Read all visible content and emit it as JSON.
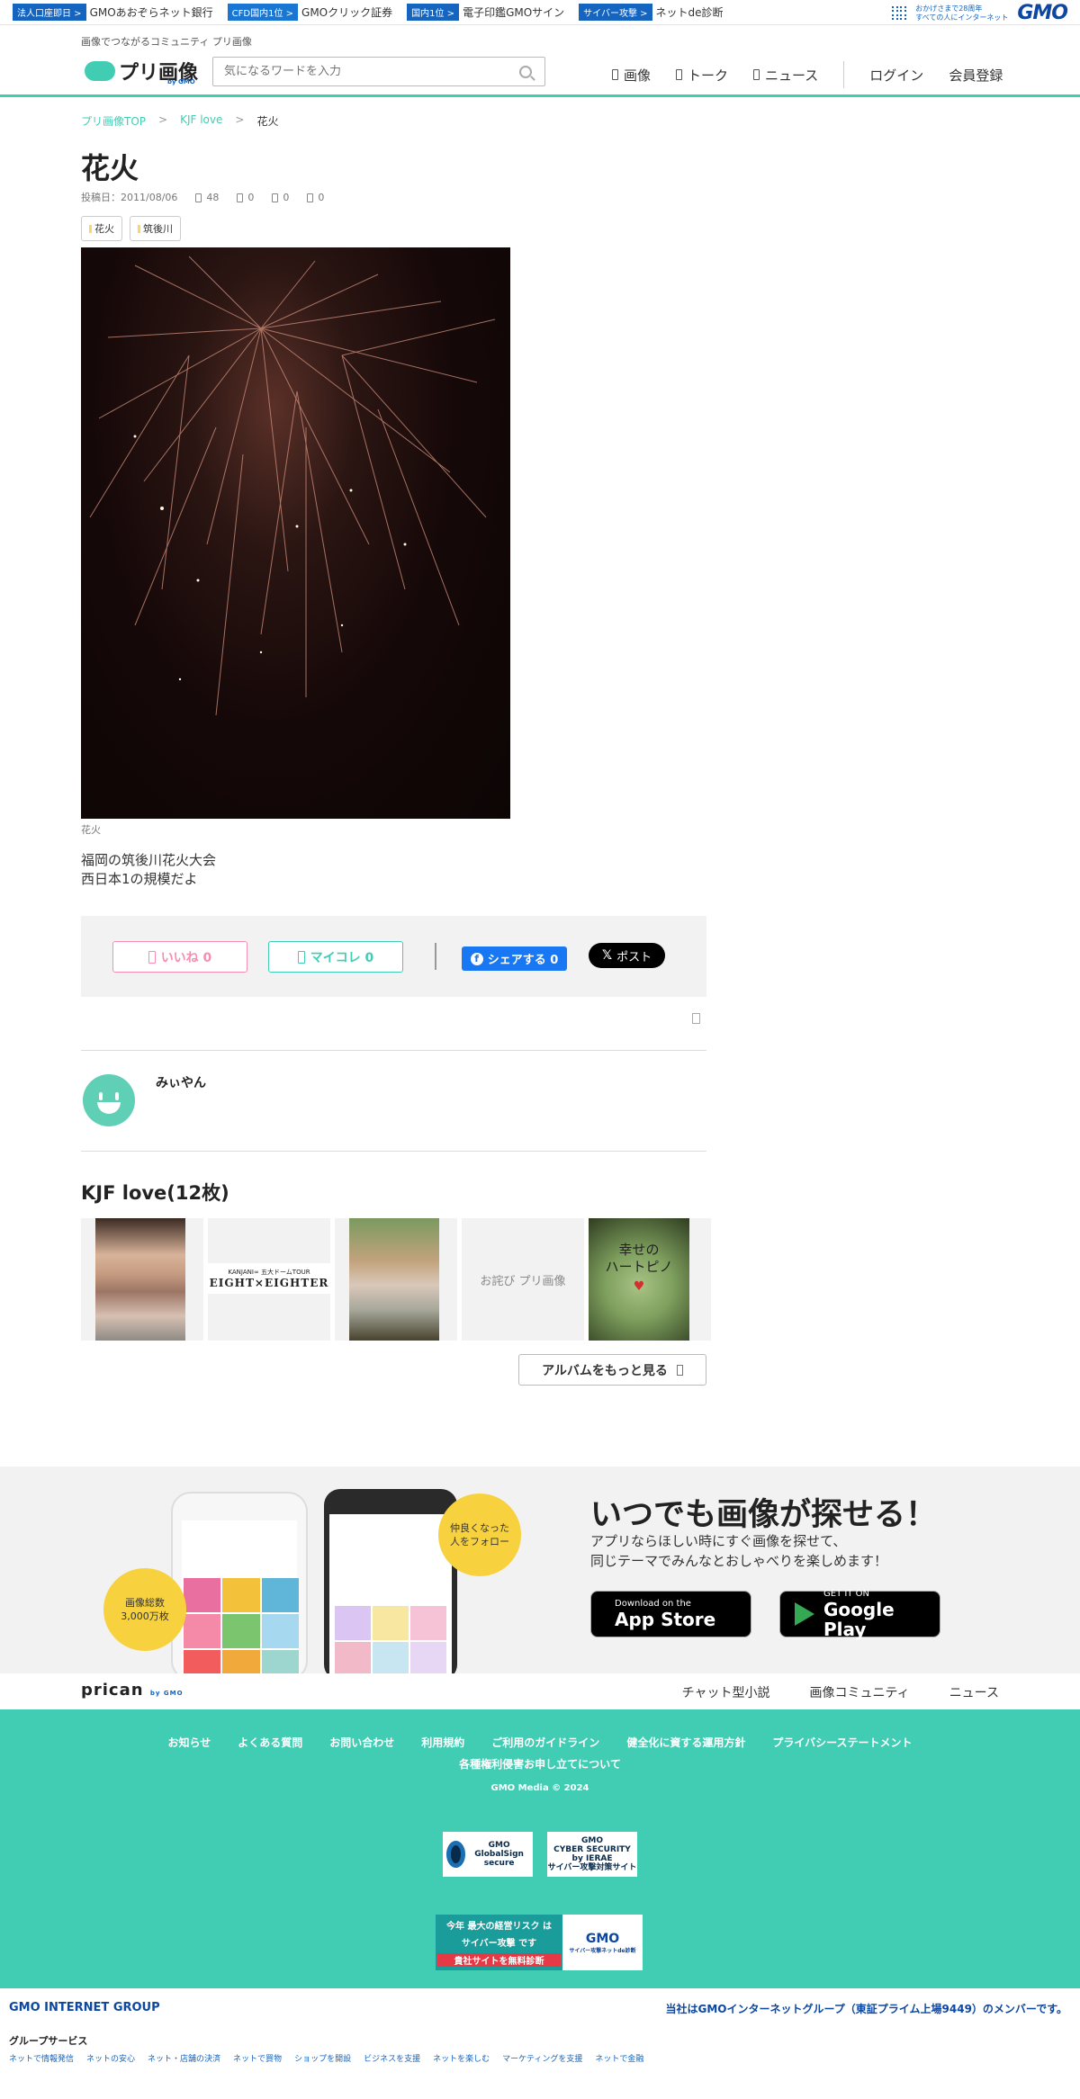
{
  "gmo_bar": {
    "items": [
      {
        "badge": "法人口座即日 >",
        "label": "GMOあおぞらネット銀行"
      },
      {
        "badge": "CFD国内1位 >",
        "label": "GMOクリック証券"
      },
      {
        "badge": "国内1位 >",
        "label": "電子印鑑GMOサイン"
      },
      {
        "badge": "サイバー攻撃 >",
        "label": "ネットde診断"
      }
    ],
    "anniv_line1": "おかげさまで28周年",
    "anniv_line2": "すべての人にインターネット",
    "logo": "GMO"
  },
  "header": {
    "tagline": "画像でつながるコミュニティ プリ画像",
    "logo_text": "プリ画像",
    "logo_by": "by GMO",
    "search_placeholder": "気になるワードを入力",
    "nav": [
      {
        "label": "画像"
      },
      {
        "label": "トーク"
      },
      {
        "label": "ニュース"
      }
    ],
    "login": "ログイン",
    "register": "会員登録"
  },
  "breadcrumb": {
    "items": [
      "プリ画像TOP",
      "KJF love",
      "花火"
    ],
    "sep": ">"
  },
  "post": {
    "title": "花火",
    "date": "投稿日：2011/08/06",
    "views": "48",
    "c1": "0",
    "c2": "0",
    "c3": "0",
    "tags": [
      "花火",
      "筑後川"
    ],
    "caption": "花火",
    "desc_line1": "福岡の筑後川花火大会",
    "desc_line2": "西日本1の規模だよ"
  },
  "actions": {
    "like": "いいね 0",
    "mycolle": "マイコレ 0",
    "fb_share": "シェアする 0",
    "x_post": "ポスト"
  },
  "user": {
    "name": "みぃやん"
  },
  "album": {
    "title": "KJF love(12枚)",
    "t2_small": "KANJANI∞ 五大ドームTOUR",
    "t2_big": "EIGHT×EIGHTER",
    "t4_alt": "お詫び プリ画像",
    "t5_text": "幸せの\nハートピノ",
    "more": "アルバムをもっと見る"
  },
  "promo": {
    "title": "いつでも画像が探せる！",
    "sub1": "アプリならほしい時にすぐ画像を探せて、",
    "sub2": "同じテーマでみんなとおしゃべりを楽しめます！",
    "bubble1_a": "画像総数",
    "bubble1_b": "3,000万枚",
    "bubble2_a": "仲良くなった",
    "bubble2_b": "人をフォロー",
    "apple_small": "Download on the",
    "apple_big": "App Store",
    "google_small": "GET IT ON",
    "google_big": "Google Play"
  },
  "subfooter": {
    "logo": "prican",
    "logo_by": "by GMO",
    "links": [
      "チャット型小説",
      "画像コミュニティ",
      "ニュース"
    ]
  },
  "footer": {
    "links": [
      "お知らせ",
      "よくある質問",
      "お問い合わせ",
      "利用規約",
      "ご利用のガイドライン",
      "健全化に資する運用方針",
      "プライバシーステートメント"
    ],
    "links2": "各種権利侵害お申し立てについて",
    "copyright": "GMO Media © 2024",
    "seal1": "GMO GlobalSign secure",
    "seal2_a": "GMO",
    "seal2_b": "CYBER SECURITY",
    "seal2_c": "by IERAE",
    "seal2_d": "サイバー攻撃対策サイト",
    "banner_a": "今年 最大の経営リスク は",
    "banner_b": "サイバー攻撃 です",
    "banner_c": "貴社サイトを無料診断",
    "banner_logo": "GMO",
    "banner_logo_sub": "サイバー攻撃ネットde診断"
  },
  "gmo_footer": {
    "ig": "GMO INTERNET GROUP",
    "member": "当社はGMOインターネットグループ（東証プライム上場9449）のメンバーです。",
    "group_services": "グループサービス",
    "services": [
      "ネットで情報発信",
      "ネットの安心",
      "ネット・店舗の決済",
      "ネットで買物",
      "ショップを開設",
      "ビジネスを支援",
      "ネットを楽しむ",
      "マーケティングを支援",
      "ネットで金融"
    ]
  }
}
